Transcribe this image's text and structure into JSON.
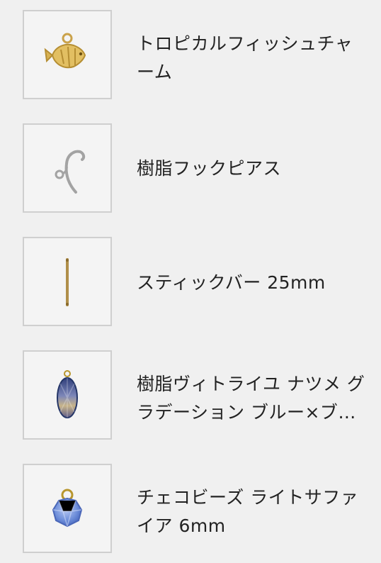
{
  "products": [
    {
      "name": "トロピカルフィッシュチャーム",
      "image": "tropical-fish-charm-icon"
    },
    {
      "name": "樹脂フックピアス",
      "image": "resin-hook-earring-icon"
    },
    {
      "name": "スティックバー 25mm",
      "image": "stick-bar-icon"
    },
    {
      "name": "樹脂ヴィトライユ ナツメ グラデーション ブルー×ブラ…",
      "image": "vitrail-bead-icon"
    },
    {
      "name": "チェコビーズ ライトサファイア 6mm",
      "image": "czech-bead-icon"
    }
  ],
  "colors": {
    "background": "#f0f0f0",
    "border": "#cfcfcf",
    "text": "#222222"
  }
}
